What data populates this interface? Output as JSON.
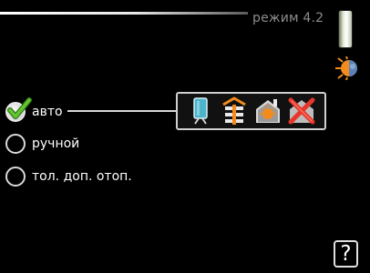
{
  "header": {
    "title": "режим 4.2"
  },
  "options": [
    {
      "label": "авто",
      "selected": true
    },
    {
      "label": "ручной",
      "selected": false
    },
    {
      "label": "тол. доп. отоп.",
      "selected": false
    }
  ],
  "icon_panel": {
    "icons": [
      "hot-water-tank-icon",
      "heating-radiator-icon",
      "additional-heat-icon",
      "cooling-disabled-icon"
    ]
  },
  "help": {
    "label": "?"
  },
  "colors": {
    "background": "#000000",
    "text": "#ffffff",
    "title": "#8c8c8c",
    "check_green": "#4caf24",
    "accent_orange": "#f28c1c",
    "cross_red": "#e8362a",
    "tank_teal": "#4db3c9"
  }
}
